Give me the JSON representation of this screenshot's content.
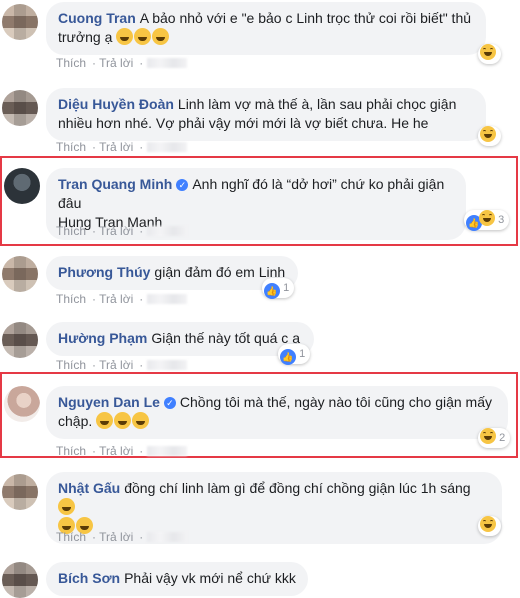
{
  "labels": {
    "like": "Thích",
    "reply": "Trả lời"
  },
  "comments": [
    {
      "name": "Cuong Tran",
      "text": "A bảo nhỏ với e \"e bảo c Linh trọc thử coi rồi biết\" thủ trưởng ạ",
      "emoji_count": 3,
      "reactions": ""
    },
    {
      "name": "Diệu Huyền Đoàn",
      "text": "Linh làm vợ mà thế à, lần sau phải chọc giận nhiều hơn nhé. Vợ phải vậy mới mới là vợ biết chưa. He he",
      "reactions": ""
    },
    {
      "name": "Tran Quang Minh",
      "text": "Anh nghĩ đó là “dở hơi” chứ ko phải giận đâu",
      "text2": "Hung Tran Manh",
      "reactions": "3"
    },
    {
      "name": "Phương Thúy",
      "text": "giận đảm đó em Linh",
      "reactions": "1"
    },
    {
      "name": "Hường Phạm",
      "text": "Giận thế này tốt quá c ạ",
      "reactions": "1"
    },
    {
      "name": "Nguyen Dan Le",
      "text": "Chồng tôi mà thế, ngày nào tôi cũng cho giận mấy chập.",
      "reactions": "2"
    },
    {
      "name": "Nhật Gấu",
      "text": "đồng chí linh làm gì để đồng chí chồng giận lúc 1h sáng",
      "reactions": ""
    },
    {
      "name": "Bích Sơn",
      "text": "Phải vậy vk mới nể chứ kkk",
      "reactions": ""
    }
  ],
  "colors": {
    "name": "#385898",
    "bubble": "#f2f3f5",
    "highlight": "#e53945",
    "meta": "#90949c"
  }
}
